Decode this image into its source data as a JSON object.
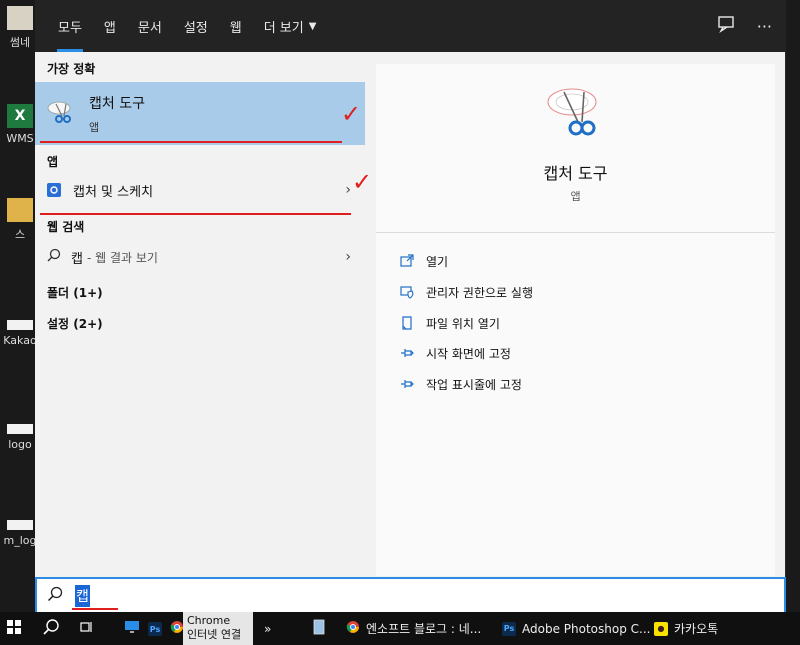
{
  "desktop": {
    "icons": [
      {
        "label": "썸네"
      },
      {
        "label": "WMS"
      },
      {
        "label": "스"
      },
      {
        "label": "Kakao"
      },
      {
        "label": "logo"
      },
      {
        "label": "m_log"
      }
    ]
  },
  "topbar": {
    "tabs": [
      {
        "label": "모두",
        "active": true
      },
      {
        "label": "앱"
      },
      {
        "label": "문서"
      },
      {
        "label": "설정"
      },
      {
        "label": "웹"
      },
      {
        "label": "더 보기"
      }
    ],
    "feedback_icon": "feedback-icon",
    "more_icon": "ellipsis-icon"
  },
  "results": {
    "best_match_heading": "가장 정확",
    "best_match": {
      "title": "캡처 도구",
      "subtitle": "앱"
    },
    "apps_heading": "앱",
    "apps": [
      {
        "label": "캡처 및 스케치"
      }
    ],
    "web_heading": "웹 검색",
    "web_query": "캡",
    "web_suffix": "- 웹 결과 보기",
    "folders_heading": "폴더 (1+)",
    "settings_heading": "설정 (2+)"
  },
  "detail": {
    "title": "캡처 도구",
    "subtitle": "앱",
    "actions": [
      {
        "label": "열기",
        "icon": "open-icon"
      },
      {
        "label": "관리자 권한으로 실행",
        "icon": "admin-shield-icon"
      },
      {
        "label": "파일 위치 열기",
        "icon": "file-location-icon"
      },
      {
        "label": "시작 화면에 고정",
        "icon": "pin-icon"
      },
      {
        "label": "작업 표시줄에 고정",
        "icon": "pin-icon"
      }
    ]
  },
  "search": {
    "value": "캡"
  },
  "taskbar": {
    "chrome_tooltip": {
      "line1": "Chrome",
      "line2": "인터넷 연결"
    },
    "overflow": "»",
    "apps": [
      {
        "label": "엔소프트 블로그 : 네...",
        "icon": "chrome-icon"
      },
      {
        "label": "Adobe Photoshop C...",
        "icon": "photoshop-icon"
      },
      {
        "label": "카카오톡",
        "icon": "kakaotalk-icon"
      }
    ]
  },
  "colors": {
    "accent": "#2a8ee6",
    "best_match_bg": "#a9cbea",
    "annotation_red": "#e01e1e",
    "search_highlight": "#1a66d6"
  }
}
